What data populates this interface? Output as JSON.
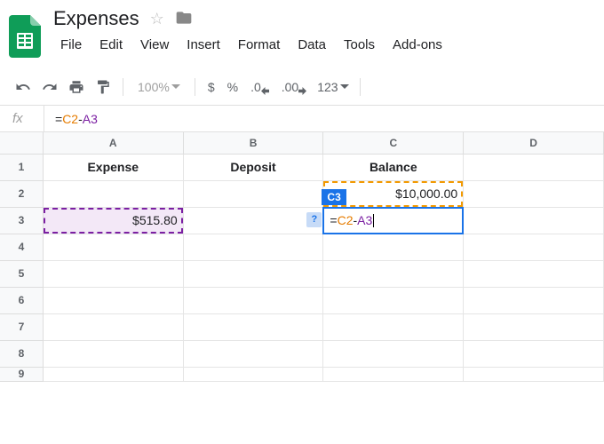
{
  "doc": {
    "title": "Expenses"
  },
  "menu": {
    "file": "File",
    "edit": "Edit",
    "view": "View",
    "insert": "Insert",
    "format": "Format",
    "data": "Data",
    "tools": "Tools",
    "addons": "Add-ons"
  },
  "toolbar": {
    "zoom": "100%",
    "currency": "$",
    "percent": "%",
    "dec_dec": ".0",
    "inc_dec": ".00",
    "more_fmt": "123"
  },
  "formula_bar": {
    "fx": "fx",
    "eq": "=",
    "ref1": "C2",
    "op": "-",
    "ref2": "A3"
  },
  "columns": {
    "A": "A",
    "B": "B",
    "C": "C",
    "D": "D"
  },
  "rows": {
    "1": "1",
    "2": "2",
    "3": "3",
    "4": "4",
    "5": "5",
    "6": "6",
    "7": "7",
    "8": "8",
    "9": "9"
  },
  "cells": {
    "A1": "Expense",
    "B1": "Deposit",
    "C1": "Balance",
    "C2": "$10,000.00",
    "A3": "$515.80"
  },
  "active": {
    "name_tag": "C3",
    "help": "?",
    "eq": "=",
    "ref1": "C2",
    "op": "-",
    "ref2": "A3"
  }
}
